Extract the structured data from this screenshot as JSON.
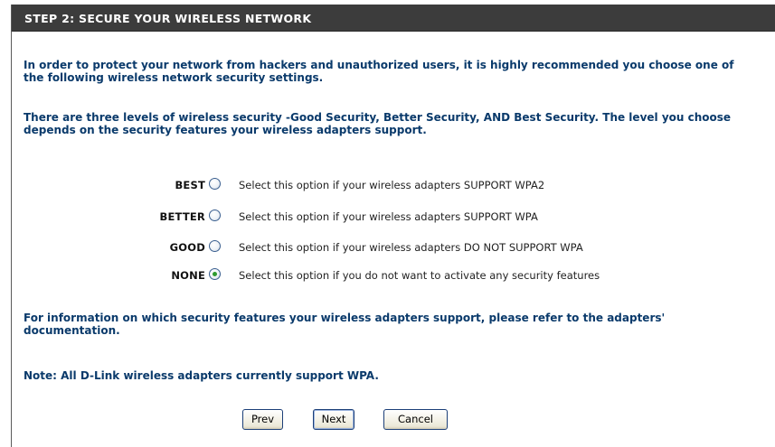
{
  "header": {
    "title": "STEP 2: SECURE YOUR WIRELESS NETWORK"
  },
  "intro": {
    "paragraph1": "In order to protect your network from hackers and unauthorized users, it is highly recommended you choose one of the following wireless network security settings.",
    "paragraph2": "There are three levels of wireless security -Good Security, Better Security, AND Best Security. The level you choose depends on the security features your wireless adapters support."
  },
  "security_options": [
    {
      "level": "BEST",
      "description": "Select this option if your wireless adapters SUPPORT WPA2",
      "selected": false
    },
    {
      "level": "BETTER",
      "description": "Select this option if your wireless adapters SUPPORT WPA",
      "selected": false
    },
    {
      "level": "GOOD",
      "description": "Select this option if your wireless adapters DO NOT SUPPORT WPA",
      "selected": false
    },
    {
      "level": "NONE",
      "description": "Select this option if you do not want to activate any security features",
      "selected": true
    }
  ],
  "footer": {
    "info": "For information on which security features your wireless adapters support, please refer to the adapters' documentation.",
    "note": "Note: All D-Link wireless adapters currently support WPA."
  },
  "buttons": {
    "prev": "Prev",
    "next": "Next",
    "cancel": "Cancel"
  },
  "colors": {
    "header_bg": "#3c3c3c",
    "text_blue": "#0a3a6b",
    "radio_checked": "#2e9a2e"
  }
}
